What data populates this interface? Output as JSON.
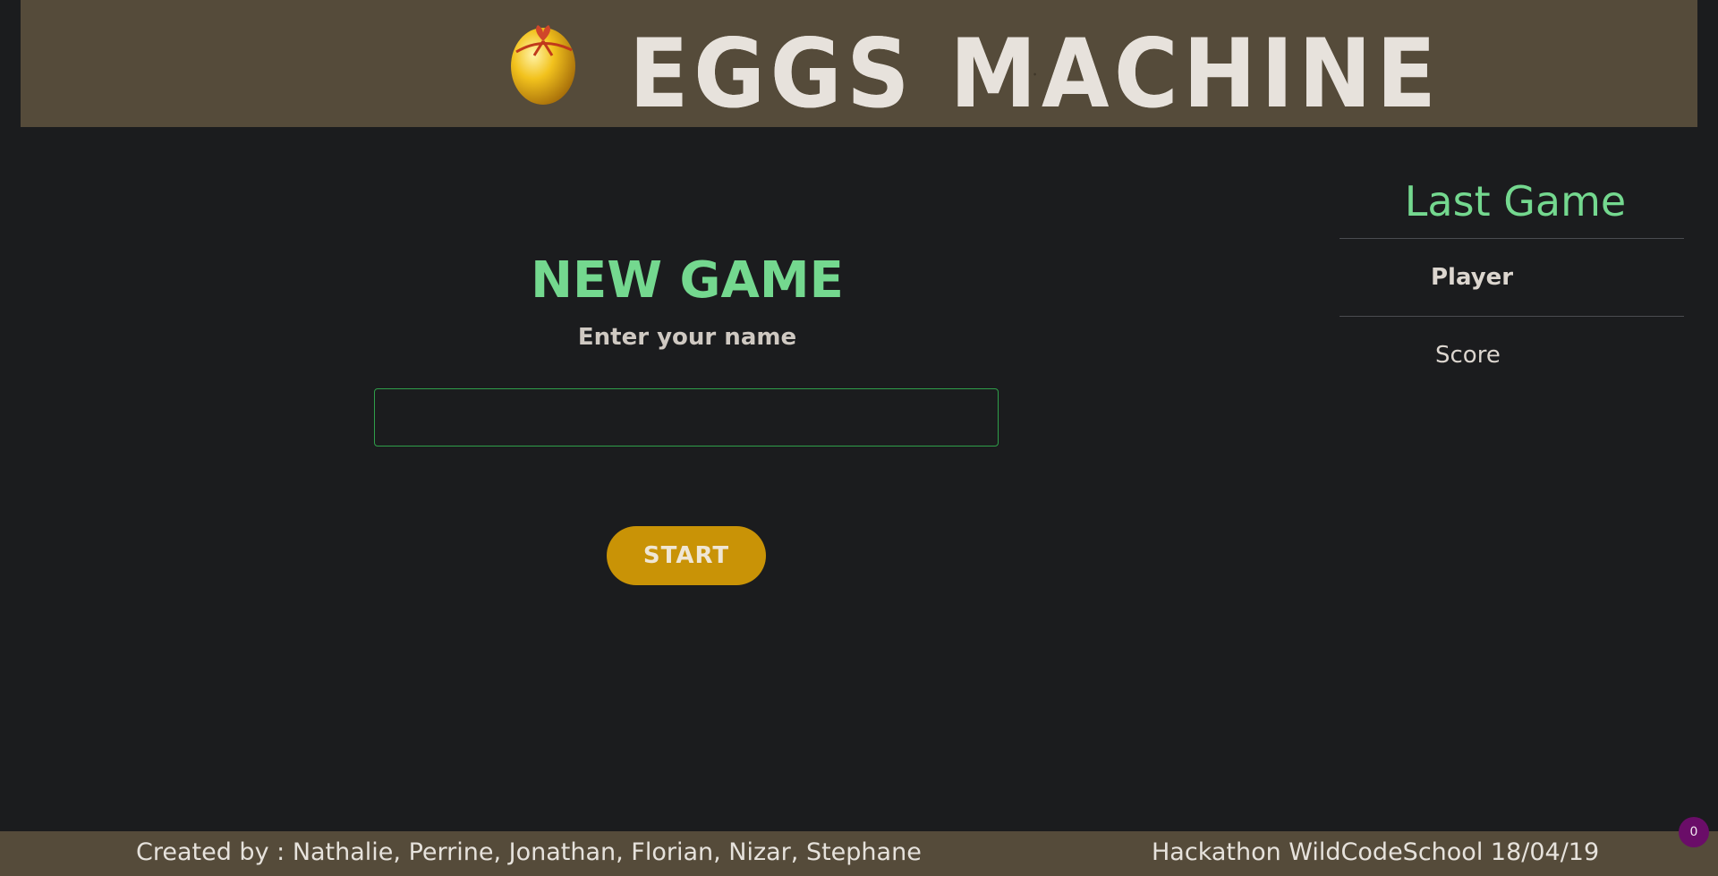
{
  "header": {
    "title": "EGGS MACHINE",
    "logo_icon": "golden-egg-icon"
  },
  "new_game": {
    "title": "NEW GAME",
    "name_label": "Enter your name",
    "name_value": "",
    "start_label": "START"
  },
  "last_game": {
    "title": "Last Game",
    "player_header": "Player",
    "score_label": "Score"
  },
  "footer": {
    "credits": "Created by : Nathalie, Perrine, Jonathan, Florian, Nizar, Stephane",
    "event": "Hackathon WildCodeSchool 18/04/19"
  },
  "badge": {
    "count": "0"
  },
  "colors": {
    "background": "#1b1c1e",
    "header_footer": "#554b3a",
    "accent_green": "#74d88f",
    "start_button": "#c99306",
    "badge": "#6a0d68"
  }
}
